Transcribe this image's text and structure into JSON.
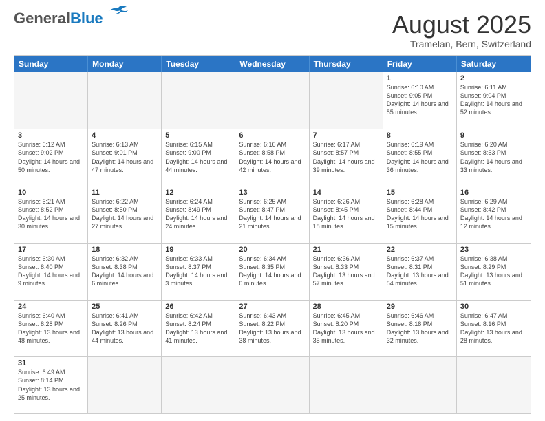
{
  "header": {
    "logo_general": "General",
    "logo_blue": "Blue",
    "month_title": "August 2025",
    "subtitle": "Tramelan, Bern, Switzerland"
  },
  "days_of_week": [
    "Sunday",
    "Monday",
    "Tuesday",
    "Wednesday",
    "Thursday",
    "Friday",
    "Saturday"
  ],
  "weeks": [
    [
      {
        "day": "",
        "info": ""
      },
      {
        "day": "",
        "info": ""
      },
      {
        "day": "",
        "info": ""
      },
      {
        "day": "",
        "info": ""
      },
      {
        "day": "",
        "info": ""
      },
      {
        "day": "1",
        "info": "Sunrise: 6:10 AM\nSunset: 9:05 PM\nDaylight: 14 hours and 55 minutes."
      },
      {
        "day": "2",
        "info": "Sunrise: 6:11 AM\nSunset: 9:04 PM\nDaylight: 14 hours and 52 minutes."
      }
    ],
    [
      {
        "day": "3",
        "info": "Sunrise: 6:12 AM\nSunset: 9:02 PM\nDaylight: 14 hours and 50 minutes."
      },
      {
        "day": "4",
        "info": "Sunrise: 6:13 AM\nSunset: 9:01 PM\nDaylight: 14 hours and 47 minutes."
      },
      {
        "day": "5",
        "info": "Sunrise: 6:15 AM\nSunset: 9:00 PM\nDaylight: 14 hours and 44 minutes."
      },
      {
        "day": "6",
        "info": "Sunrise: 6:16 AM\nSunset: 8:58 PM\nDaylight: 14 hours and 42 minutes."
      },
      {
        "day": "7",
        "info": "Sunrise: 6:17 AM\nSunset: 8:57 PM\nDaylight: 14 hours and 39 minutes."
      },
      {
        "day": "8",
        "info": "Sunrise: 6:19 AM\nSunset: 8:55 PM\nDaylight: 14 hours and 36 minutes."
      },
      {
        "day": "9",
        "info": "Sunrise: 6:20 AM\nSunset: 8:53 PM\nDaylight: 14 hours and 33 minutes."
      }
    ],
    [
      {
        "day": "10",
        "info": "Sunrise: 6:21 AM\nSunset: 8:52 PM\nDaylight: 14 hours and 30 minutes."
      },
      {
        "day": "11",
        "info": "Sunrise: 6:22 AM\nSunset: 8:50 PM\nDaylight: 14 hours and 27 minutes."
      },
      {
        "day": "12",
        "info": "Sunrise: 6:24 AM\nSunset: 8:49 PM\nDaylight: 14 hours and 24 minutes."
      },
      {
        "day": "13",
        "info": "Sunrise: 6:25 AM\nSunset: 8:47 PM\nDaylight: 14 hours and 21 minutes."
      },
      {
        "day": "14",
        "info": "Sunrise: 6:26 AM\nSunset: 8:45 PM\nDaylight: 14 hours and 18 minutes."
      },
      {
        "day": "15",
        "info": "Sunrise: 6:28 AM\nSunset: 8:44 PM\nDaylight: 14 hours and 15 minutes."
      },
      {
        "day": "16",
        "info": "Sunrise: 6:29 AM\nSunset: 8:42 PM\nDaylight: 14 hours and 12 minutes."
      }
    ],
    [
      {
        "day": "17",
        "info": "Sunrise: 6:30 AM\nSunset: 8:40 PM\nDaylight: 14 hours and 9 minutes."
      },
      {
        "day": "18",
        "info": "Sunrise: 6:32 AM\nSunset: 8:38 PM\nDaylight: 14 hours and 6 minutes."
      },
      {
        "day": "19",
        "info": "Sunrise: 6:33 AM\nSunset: 8:37 PM\nDaylight: 14 hours and 3 minutes."
      },
      {
        "day": "20",
        "info": "Sunrise: 6:34 AM\nSunset: 8:35 PM\nDaylight: 14 hours and 0 minutes."
      },
      {
        "day": "21",
        "info": "Sunrise: 6:36 AM\nSunset: 8:33 PM\nDaylight: 13 hours and 57 minutes."
      },
      {
        "day": "22",
        "info": "Sunrise: 6:37 AM\nSunset: 8:31 PM\nDaylight: 13 hours and 54 minutes."
      },
      {
        "day": "23",
        "info": "Sunrise: 6:38 AM\nSunset: 8:29 PM\nDaylight: 13 hours and 51 minutes."
      }
    ],
    [
      {
        "day": "24",
        "info": "Sunrise: 6:40 AM\nSunset: 8:28 PM\nDaylight: 13 hours and 48 minutes."
      },
      {
        "day": "25",
        "info": "Sunrise: 6:41 AM\nSunset: 8:26 PM\nDaylight: 13 hours and 44 minutes."
      },
      {
        "day": "26",
        "info": "Sunrise: 6:42 AM\nSunset: 8:24 PM\nDaylight: 13 hours and 41 minutes."
      },
      {
        "day": "27",
        "info": "Sunrise: 6:43 AM\nSunset: 8:22 PM\nDaylight: 13 hours and 38 minutes."
      },
      {
        "day": "28",
        "info": "Sunrise: 6:45 AM\nSunset: 8:20 PM\nDaylight: 13 hours and 35 minutes."
      },
      {
        "day": "29",
        "info": "Sunrise: 6:46 AM\nSunset: 8:18 PM\nDaylight: 13 hours and 32 minutes."
      },
      {
        "day": "30",
        "info": "Sunrise: 6:47 AM\nSunset: 8:16 PM\nDaylight: 13 hours and 28 minutes."
      }
    ],
    [
      {
        "day": "31",
        "info": "Sunrise: 6:49 AM\nSunset: 8:14 PM\nDaylight: 13 hours and 25 minutes."
      },
      {
        "day": "",
        "info": ""
      },
      {
        "day": "",
        "info": ""
      },
      {
        "day": "",
        "info": ""
      },
      {
        "day": "",
        "info": ""
      },
      {
        "day": "",
        "info": ""
      },
      {
        "day": "",
        "info": ""
      }
    ]
  ]
}
